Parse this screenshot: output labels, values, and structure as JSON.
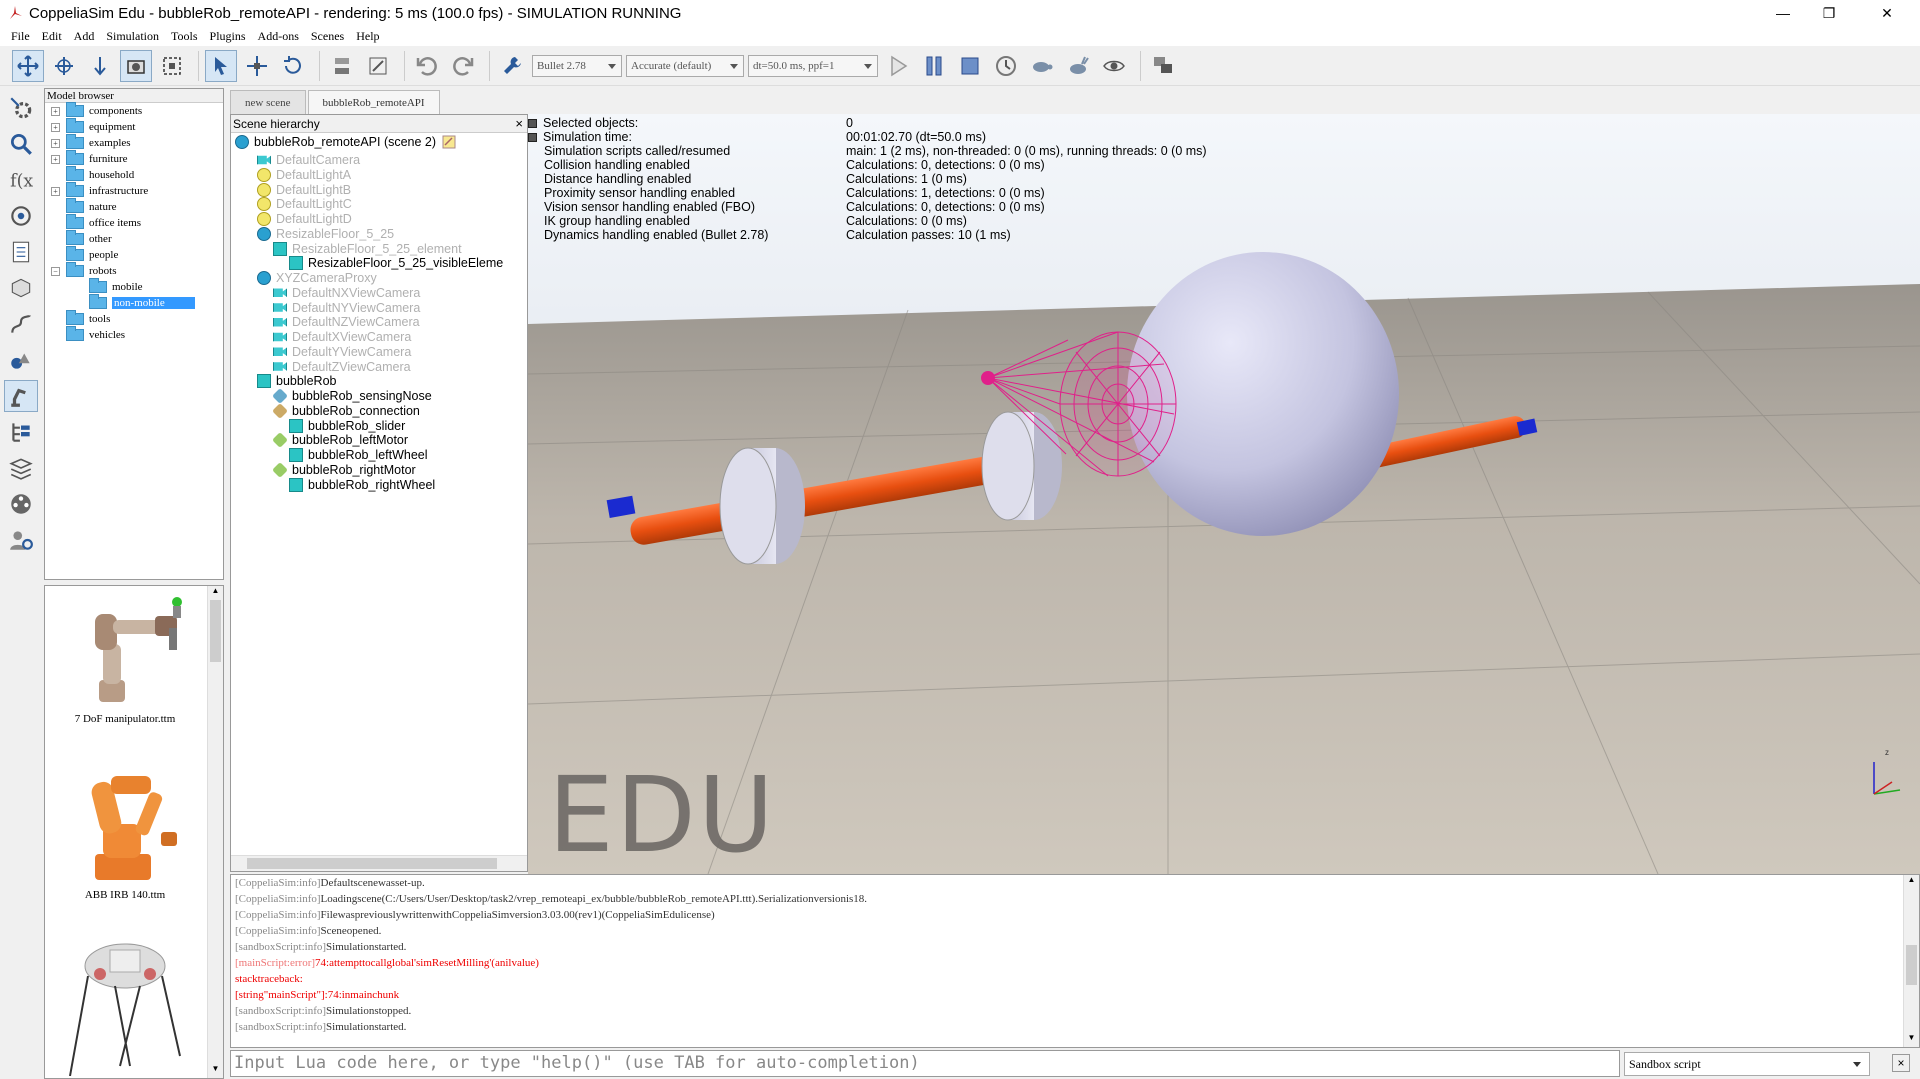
{
  "window": {
    "title": "CoppeliaSim Edu - bubbleRob_remoteAPI - rendering: 5 ms (100.0 fps) - SIMULATION RUNNING",
    "minimize": "—",
    "restore": "❐",
    "close": "✕"
  },
  "menu": [
    "File",
    "Edit",
    "Add",
    "Simulation",
    "Tools",
    "Plugins",
    "Add-ons",
    "Scenes",
    "Help"
  ],
  "toolbar": {
    "engine": "Bullet 2.78",
    "accuracy": "Accurate (default)",
    "timestep": "dt=50.0 ms, ppf=1"
  },
  "model_browser": {
    "title": "Model browser",
    "items": [
      {
        "label": "components",
        "expandable": true
      },
      {
        "label": "equipment",
        "expandable": true
      },
      {
        "label": "examples",
        "expandable": true
      },
      {
        "label": "furniture",
        "expandable": true
      },
      {
        "label": "household",
        "expandable": false
      },
      {
        "label": "infrastructure",
        "expandable": true
      },
      {
        "label": "nature",
        "expandable": false
      },
      {
        "label": "office items",
        "expandable": false
      },
      {
        "label": "other",
        "expandable": false
      },
      {
        "label": "people",
        "expandable": false
      },
      {
        "label": "robots",
        "expandable": true,
        "expanded": true
      },
      {
        "label": "mobile",
        "child": true
      },
      {
        "label": "non-mobile",
        "child": true,
        "selected": true
      },
      {
        "label": "tools",
        "expandable": false
      },
      {
        "label": "vehicles",
        "expandable": false
      }
    ],
    "thumbnails": [
      "7 DoF manipulator.ttm",
      "ABB IRB 140.ttm"
    ]
  },
  "tabs": [
    "new scene",
    "bubbleRob_remoteAPI"
  ],
  "hierarchy": {
    "title": "Scene hierarchy",
    "close": "×",
    "root": "bubbleRob_remoteAPI (scene 2)",
    "items": [
      {
        "label": "DefaultCamera",
        "icon": "camera",
        "level": 1,
        "dim": true
      },
      {
        "label": "DefaultLightA",
        "icon": "light",
        "level": 1,
        "dim": true
      },
      {
        "label": "DefaultLightB",
        "icon": "light",
        "level": 1,
        "dim": true
      },
      {
        "label": "DefaultLightC",
        "icon": "light",
        "level": 1,
        "dim": true
      },
      {
        "label": "DefaultLightD",
        "icon": "light",
        "level": 1,
        "dim": true
      },
      {
        "label": "ResizableFloor_5_25",
        "icon": "model",
        "level": 1,
        "dim": true
      },
      {
        "label": "ResizableFloor_5_25_element",
        "icon": "cube",
        "level": 2,
        "dim": true
      },
      {
        "label": "ResizableFloor_5_25_visibleEleme",
        "icon": "shape",
        "level": 3,
        "dim": false
      },
      {
        "label": "XYZCameraProxy",
        "icon": "model",
        "level": 1,
        "dim": true
      },
      {
        "label": "DefaultNXViewCamera",
        "icon": "camera",
        "level": 2,
        "dim": true
      },
      {
        "label": "DefaultNYViewCamera",
        "icon": "camera",
        "level": 2,
        "dim": true
      },
      {
        "label": "DefaultNZViewCamera",
        "icon": "camera",
        "level": 2,
        "dim": true
      },
      {
        "label": "DefaultXViewCamera",
        "icon": "camera",
        "level": 2,
        "dim": true
      },
      {
        "label": "DefaultYViewCamera",
        "icon": "camera",
        "level": 2,
        "dim": true
      },
      {
        "label": "DefaultZViewCamera",
        "icon": "camera",
        "level": 2,
        "dim": true
      },
      {
        "label": "bubbleRob",
        "icon": "cube",
        "level": 1,
        "dim": false
      },
      {
        "label": "bubbleRob_sensingNose",
        "icon": "sensor",
        "level": 2,
        "dim": false
      },
      {
        "label": "bubbleRob_connection",
        "icon": "dummy",
        "level": 2,
        "dim": false
      },
      {
        "label": "bubbleRob_slider",
        "icon": "cube",
        "level": 3,
        "dim": false
      },
      {
        "label": "bubbleRob_leftMotor",
        "icon": "joint",
        "level": 2,
        "dim": false
      },
      {
        "label": "bubbleRob_leftWheel",
        "icon": "cube",
        "level": 3,
        "dim": false
      },
      {
        "label": "bubbleRob_rightMotor",
        "icon": "joint",
        "level": 2,
        "dim": false
      },
      {
        "label": "bubbleRob_rightWheel",
        "icon": "cube",
        "level": 3,
        "dim": false
      }
    ]
  },
  "info": [
    {
      "k": "Selected objects:",
      "v": "0",
      "sq": true
    },
    {
      "k": "Simulation time:",
      "v": "00:01:02.70 (dt=50.0 ms)",
      "sq": true
    },
    {
      "k": "Simulation scripts called/resumed",
      "v": "main: 1 (2 ms), non-threaded: 0 (0 ms), running threads: 0 (0 ms)"
    },
    {
      "k": "Collision handling enabled",
      "v": "Calculations: 0, detections: 0 (0 ms)"
    },
    {
      "k": "Distance handling enabled",
      "v": "Calculations: 1 (0 ms)"
    },
    {
      "k": "Proximity sensor handling enabled",
      "v": "Calculations: 1, detections: 0 (0 ms)"
    },
    {
      "k": "Vision sensor handling enabled (FBO)",
      "v": "Calculations: 0, detections: 0 (0 ms)"
    },
    {
      "k": "IK group handling enabled",
      "v": "Calculations: 0 (0 ms)"
    },
    {
      "k": "Dynamics handling enabled (Bullet 2.78)",
      "v": "Calculation passes: 10 (1 ms)"
    }
  ],
  "watermark": "EDU",
  "axis_label": "z",
  "console": [
    {
      "tag": "[CoppeliaSim:info]",
      "msg": "Defaultscenewasset-up."
    },
    {
      "tag": "[CoppeliaSim:info]",
      "msg": "Loadingscene(C:/Users/User/Desktop/task2/vrep_remoteapi_ex/bubble/bubbleRob_remoteAPI.ttt).Serializationversionis18."
    },
    {
      "tag": "[CoppeliaSim:info]",
      "msg": "FilewaspreviouslywrittenwithCoppeliaSimversion3.03.00(rev1)(CoppeliaSimEdulicense)"
    },
    {
      "tag": "[CoppeliaSim:info]",
      "msg": "Sceneopened."
    },
    {
      "tag": "[sandboxScript:info]",
      "msg": "Simulationstarted."
    },
    {
      "tag": "[mainScript:error]",
      "msg": "74:attempttocallglobal'simResetMilling'(anilvalue)",
      "err": true
    },
    {
      "tag": "",
      "msg": "stacktraceback:",
      "err": true
    },
    {
      "tag": "",
      "msg": "[string\"mainScript\"]:74:inmainchunk",
      "err": true
    },
    {
      "tag": "[sandboxScript:info]",
      "msg": "Simulationstopped."
    },
    {
      "tag": "[sandboxScript:info]",
      "msg": "Simulationstarted."
    }
  ],
  "input": {
    "placeholder": "Input Lua code here, or type \"help()\" (use TAB for auto-completion)"
  },
  "script_select": "Sandbox script",
  "console_close": "×"
}
